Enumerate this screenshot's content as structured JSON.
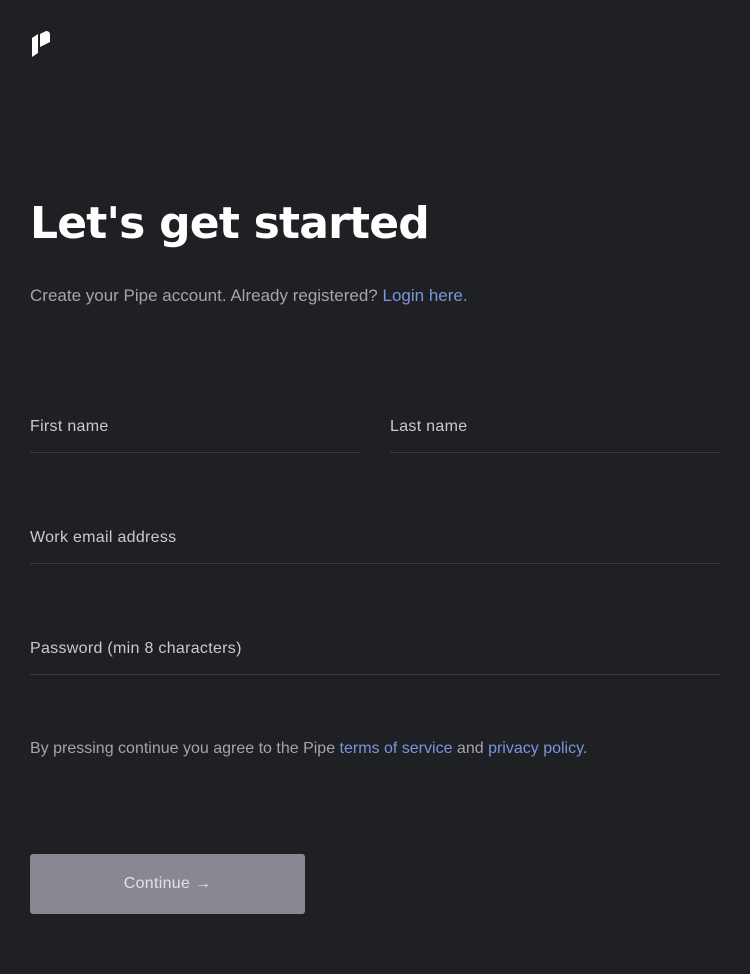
{
  "brand": {
    "logo_icon": "pipe-logo-icon"
  },
  "heading": {
    "title": "Let's get started"
  },
  "intro": {
    "text": "Create your Pipe account. Already registered?",
    "login_link": "Login here."
  },
  "form": {
    "first_name": {
      "placeholder": "First name",
      "value": ""
    },
    "last_name": {
      "placeholder": "Last name",
      "value": ""
    },
    "email": {
      "placeholder": "Work email address",
      "value": ""
    },
    "password": {
      "placeholder": "Password (min 8 characters)",
      "value": ""
    }
  },
  "legal": {
    "prefix": "By pressing continue you agree to the Pipe",
    "terms_link": "terms of service",
    "middle": "and",
    "privacy_link": "privacy policy",
    "suffix": "."
  },
  "actions": {
    "continue_label": "Continue →"
  },
  "colors": {
    "background": "#1f2024",
    "link": "#7b94dd",
    "muted_text": "#a3a5ab",
    "button_disabled": "#878892"
  }
}
